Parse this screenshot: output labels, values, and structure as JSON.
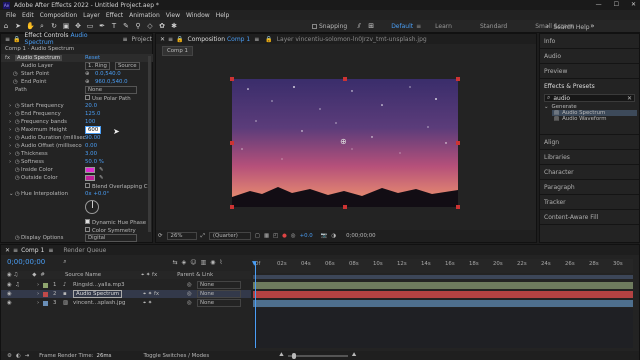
{
  "window": {
    "title": "Adobe After Effects 2022 - Untitled Project.aep *",
    "controls": [
      "—",
      "☐",
      "✕"
    ]
  },
  "menu": [
    "File",
    "Edit",
    "Composition",
    "Layer",
    "Effect",
    "Animation",
    "View",
    "Window",
    "Help"
  ],
  "toolbar": {
    "snapping": "Snapping",
    "workspaces": [
      "Default",
      "Learn",
      "Standard",
      "Small Screen"
    ],
    "active_workspace": "Default",
    "search_help": "Search Help"
  },
  "effect_controls": {
    "tab": "Effect Controls Audio Spectrum",
    "tab_title": "Effect Controls",
    "tab_layer": "Audio Spectrum",
    "project_tab": "Project",
    "breadcrumb": "Comp 1 · Audio Spectrum",
    "effect_name": "Audio Spectrum",
    "reset": "Reset",
    "rows": [
      {
        "label": "Audio Layer",
        "value": "1. Ring",
        "value2": "Source"
      },
      {
        "label": "Start Point",
        "value": "0.0,540.0"
      },
      {
        "label": "End Point",
        "value": "960.0,540.0"
      },
      {
        "label": "Path",
        "value": "None"
      },
      {
        "label": "",
        "value": "Use Polar Path"
      },
      {
        "label": "Start Frequency",
        "value": "20.0"
      },
      {
        "label": "End Frequency",
        "value": "125.0"
      },
      {
        "label": "Frequency bands",
        "value": "100"
      },
      {
        "label": "Maximum Height",
        "value": "600"
      },
      {
        "label": "Audio Duration (millisec",
        "value": "90.00"
      },
      {
        "label": "Audio Offset (milliseco",
        "value": "0.00"
      },
      {
        "label": "Thickness",
        "value": "3.00"
      },
      {
        "label": "Softness",
        "value": "50.0 %"
      },
      {
        "label": "Inside Color",
        "value": ""
      },
      {
        "label": "Outside Color",
        "value": ""
      },
      {
        "label": "",
        "value": "Blend Overlapping C"
      },
      {
        "label": "Hue Interpolation",
        "value": "0x +0.0°"
      },
      {
        "label": "",
        "value": ""
      },
      {
        "label": "",
        "value": ""
      },
      {
        "label": "",
        "value": "Dynamic Hue Phase"
      },
      {
        "label": "",
        "value": "Color Symmetry"
      },
      {
        "label": "Display Options",
        "value": "Digital"
      }
    ],
    "colors": {
      "inside": "#e02bd0",
      "outside": "#c1209a"
    }
  },
  "composition": {
    "tab": "Composition",
    "tab_comp": "Comp 1",
    "layer_tab": "Layer  vincentiu-solomon-ln0Jrzv_tmt-unsplash.jpg",
    "comp_chip": "Comp 1",
    "zoom": "26%",
    "resolution": "(Quarter)",
    "exposure": "+0.0",
    "timecode": "0;00;00;00",
    "sky_top": "#3a2d6b",
    "sky_bottom": "#f39a6d"
  },
  "right_panel": {
    "top_items": [
      "Info",
      "Audio",
      "Preview"
    ],
    "effects_title": "Effects & Presets",
    "search_value": "audio",
    "generate_folder": "Generate",
    "effect_items": [
      "Audio Spectrum",
      "Audio Waveform"
    ],
    "bottom_items": [
      "Align",
      "Libraries",
      "Character",
      "Paragraph",
      "Tracker",
      "Content-Aware Fill"
    ]
  },
  "timeline": {
    "tab": "Comp 1",
    "render_queue": "Render Queue",
    "timecode": "0;00;00;00",
    "columns": {
      "source": "Source Name",
      "parent": "Parent & Link"
    },
    "ruler": [
      "0f",
      "02s",
      "04s",
      "06s",
      "08s",
      "10s",
      "12s",
      "14s",
      "16s",
      "18s",
      "20s",
      "22s",
      "24s",
      "26s",
      "28s",
      "30s"
    ],
    "layers": [
      {
        "num": "1",
        "name": "Ringsld...yalla.mp3",
        "parent": "None",
        "color": "#8fa56e",
        "bar": "#6e7b5e",
        "selected": false
      },
      {
        "num": "2",
        "name": "Audio Spectrum",
        "parent": "None",
        "color": "#c04a4a",
        "bar": "#b34242",
        "selected": true
      },
      {
        "num": "3",
        "name": "vincent...splash.jpg",
        "parent": "None",
        "color": "#6a8fb8",
        "bar": "#4e6f8e",
        "selected": false
      }
    ],
    "footer": {
      "render_time_label": "Frame Render Time:",
      "render_time": "26ms",
      "toggle": "Toggle Switches / Modes"
    }
  }
}
